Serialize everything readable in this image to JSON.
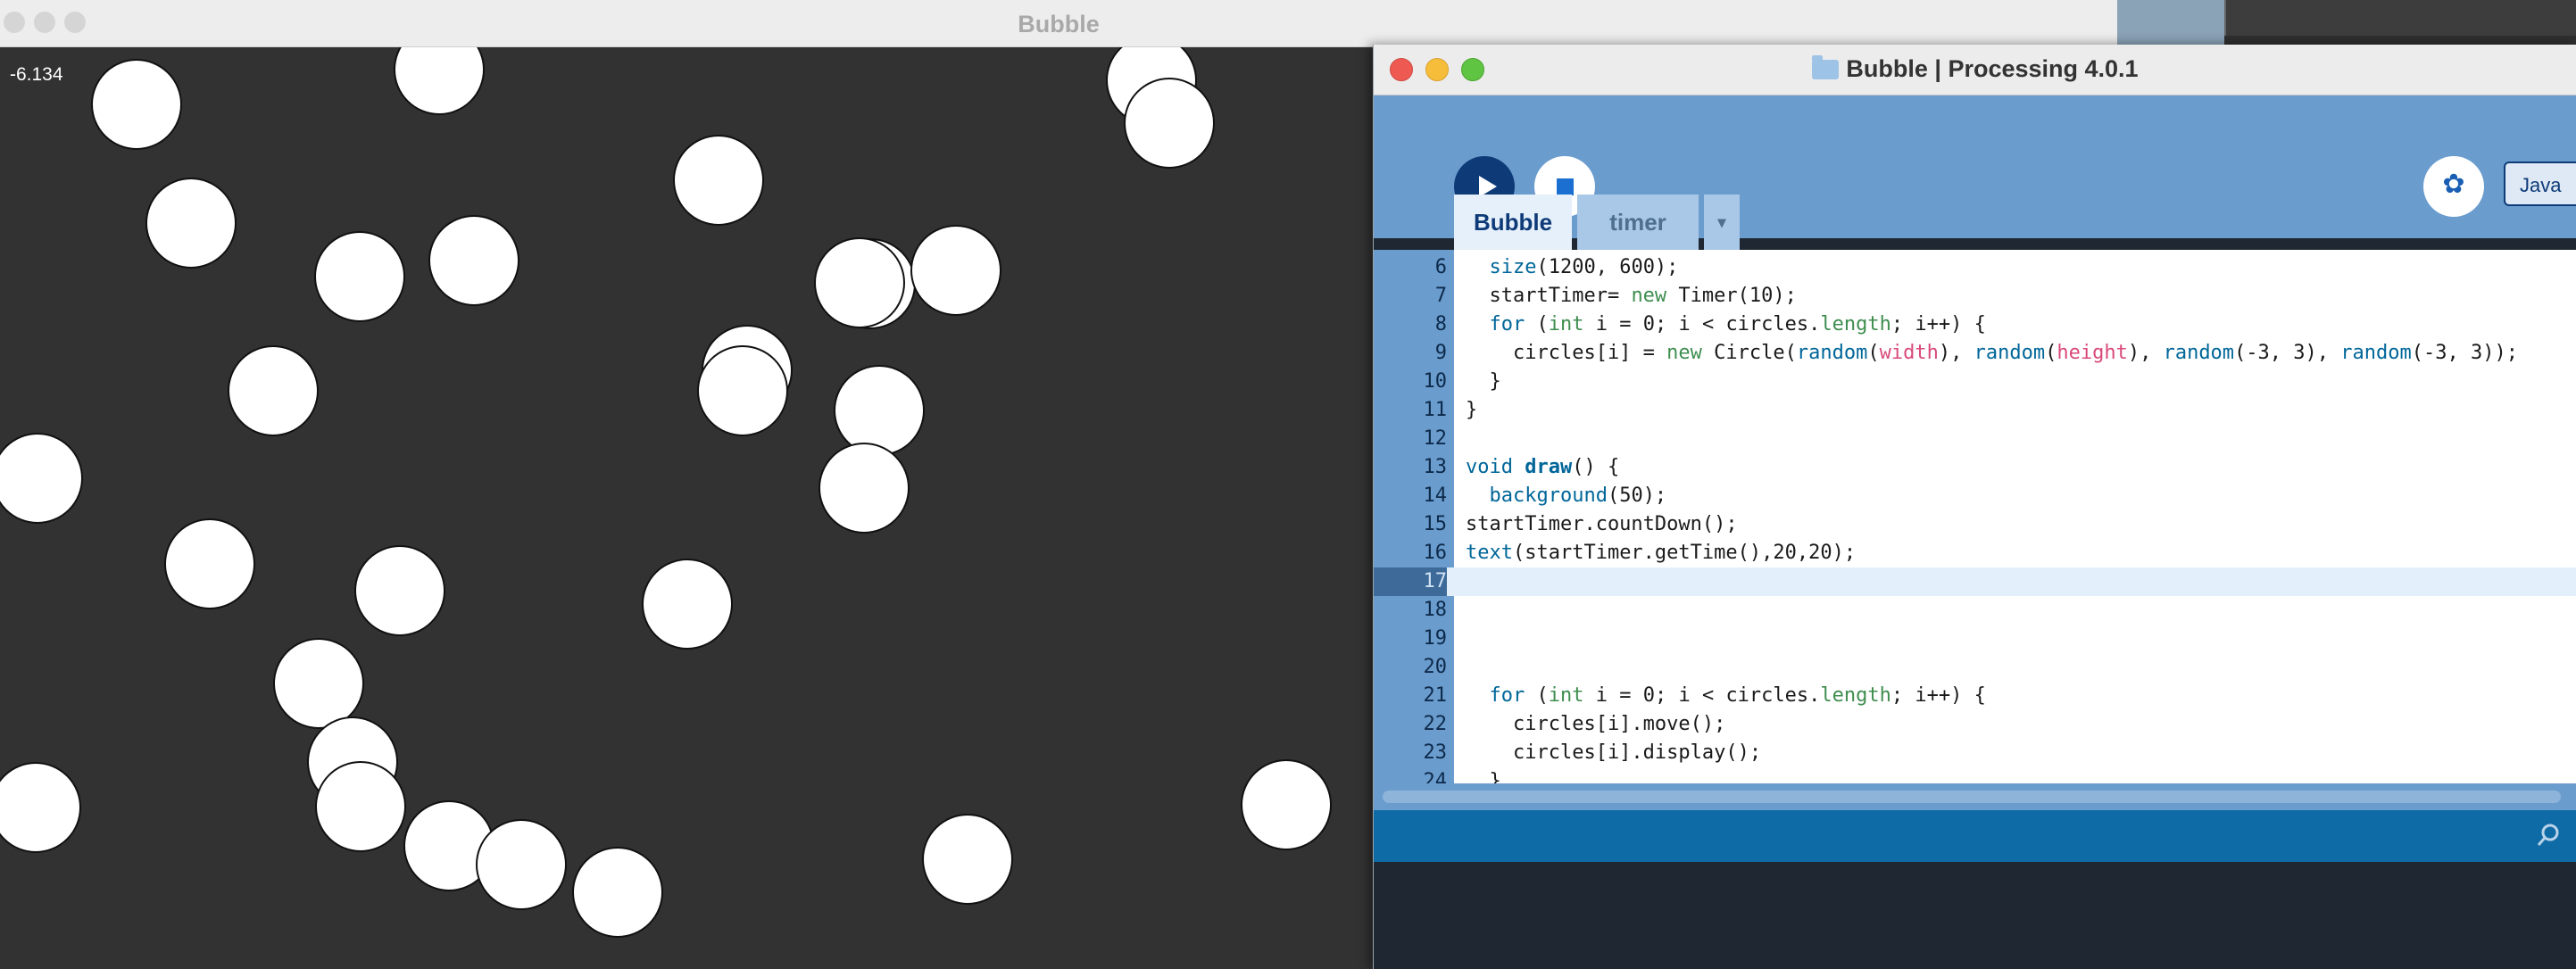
{
  "sketch_window": {
    "title": "Bubble",
    "timer_text": "-6.134",
    "background_color": "#323232",
    "circle_color": "#ffffff"
  },
  "ide_window": {
    "title": "Bubble | Processing 4.0.1",
    "mode_label": "Java",
    "tabs": [
      "Bubble",
      "timer"
    ],
    "tab_menu_glyph": "▾",
    "debug_glyph": "✿",
    "accent_color": "#0e3b78",
    "toolbar_color": "#6a9cce",
    "status_color": "#0f6ba5",
    "code_lines": [
      {
        "n": "6",
        "text": "  size(1200, 600);"
      },
      {
        "n": "7",
        "text": "  startTimer= new Timer(10);"
      },
      {
        "n": "8",
        "text": "  for (int i = 0; i < circles.length; i++) {"
      },
      {
        "n": "9",
        "text": "    circles[i] = new Circle(random(width), random(height), random(-3, 3), random(-3, 3));"
      },
      {
        "n": "10",
        "text": "  }"
      },
      {
        "n": "11",
        "text": "}"
      },
      {
        "n": "12",
        "text": ""
      },
      {
        "n": "13",
        "text": "void draw() {"
      },
      {
        "n": "14",
        "text": "  background(50);"
      },
      {
        "n": "15",
        "text": "startTimer.countDown();"
      },
      {
        "n": "16",
        "text": "text(startTimer.getTime(),20,20);"
      },
      {
        "n": "17",
        "text": ""
      },
      {
        "n": "18",
        "text": ""
      },
      {
        "n": "19",
        "text": ""
      },
      {
        "n": "20",
        "text": ""
      },
      {
        "n": "21",
        "text": "  for (int i = 0; i < circles.length; i++) {"
      },
      {
        "n": "22",
        "text": "    circles[i].move();"
      },
      {
        "n": "23",
        "text": "    circles[i].display();"
      },
      {
        "n": "24",
        "text": "  }"
      }
    ]
  }
}
